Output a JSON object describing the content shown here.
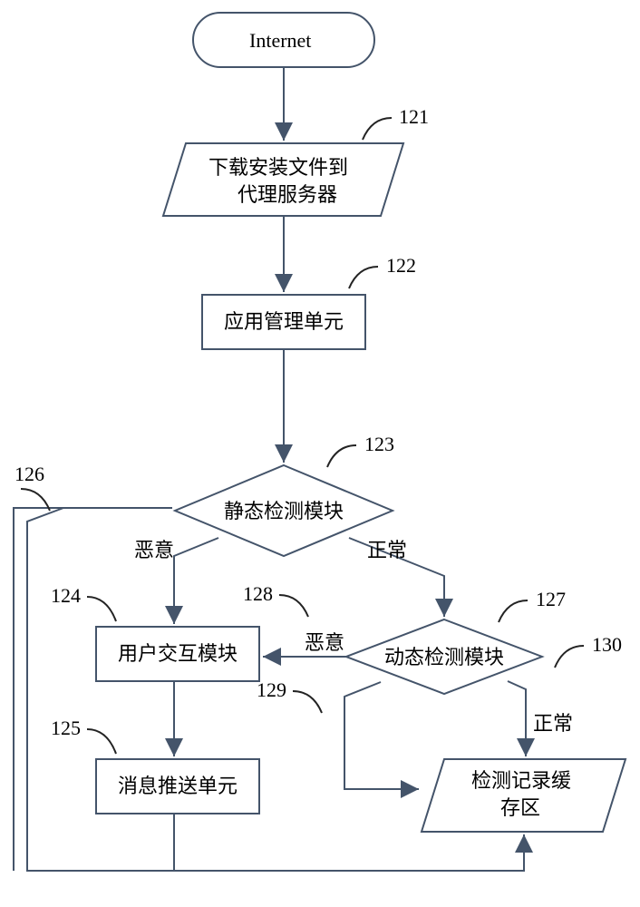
{
  "nodes": {
    "internet": "Internet",
    "download_line1": "下载安装文件到",
    "download_line2": "代理服务器",
    "app_mgmt": "应用管理单元",
    "static_detect": "静态检测模块",
    "user_interact": "用户交互模块",
    "msg_push": "消息推送单元",
    "dynamic_detect": "动态检测模块",
    "record_cache_line1": "检测记录缓",
    "record_cache_line2": "存区"
  },
  "edges": {
    "malicious": "恶意",
    "normal": "正常"
  },
  "callouts": {
    "n121": "121",
    "n122": "122",
    "n123": "123",
    "n124": "124",
    "n125": "125",
    "n126": "126",
    "n127": "127",
    "n128": "128",
    "n129": "129",
    "n130": "130"
  }
}
